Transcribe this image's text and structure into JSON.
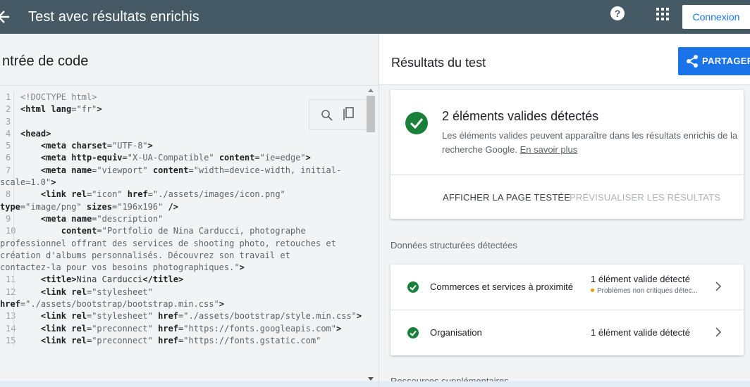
{
  "app": {
    "title": "Test avec résultats enrichis",
    "help_label": "?",
    "signin_label": "Connexion"
  },
  "left": {
    "title": "ntrée de code"
  },
  "right": {
    "title": "Résultats du test",
    "share_label": "PARTAGER",
    "summary": {
      "title": "2 éléments valides détectés",
      "desc": "Les éléments valides peuvent apparaître dans les résultats enrichis de la recherche Google.",
      "learn_more": "En savoir plus",
      "view_page": "AFFICHER LA PAGE TESTÉE",
      "preview": "PRÉVISUALISER LES RÉSULTATS"
    },
    "section_label": "Données structurées détectées",
    "items": [
      {
        "name": "Commerces et services à proximité",
        "status": "1 élément valide détecté",
        "warning": "Problèmes non critiques détec..."
      },
      {
        "name": "Organisation",
        "status": "1 élément valide détecté"
      }
    ],
    "resources_label": "Ressources supplémentaires"
  },
  "colors": {
    "topbar": "#455a64",
    "accent": "#1a73e8",
    "success": "#188038",
    "warning": "#f29900"
  },
  "code_lines": [
    {
      "ln": "1",
      "parts": [
        [
          "cmt",
          "<!DOCTYPE html>"
        ]
      ]
    },
    {
      "ln": "2",
      "parts": [
        [
          "tag",
          "<html"
        ],
        [
          "txt",
          " "
        ],
        [
          "attr",
          "lang"
        ],
        [
          "txt",
          "="
        ],
        [
          "val",
          "\"fr\""
        ],
        [
          "tag",
          ">"
        ]
      ]
    },
    {
      "ln": "3",
      "parts": []
    },
    {
      "ln": "4",
      "parts": [
        [
          "tag",
          "<head>"
        ]
      ]
    },
    {
      "ln": "5",
      "parts": [
        [
          "txt",
          "    "
        ],
        [
          "tag",
          "<meta"
        ],
        [
          "txt",
          " "
        ],
        [
          "attr",
          "charset"
        ],
        [
          "txt",
          "="
        ],
        [
          "val",
          "\"UTF-8\""
        ],
        [
          "tag",
          ">"
        ]
      ]
    },
    {
      "ln": "6",
      "parts": [
        [
          "txt",
          "    "
        ],
        [
          "tag",
          "<meta"
        ],
        [
          "txt",
          " "
        ],
        [
          "attr",
          "http-equiv"
        ],
        [
          "txt",
          "="
        ],
        [
          "val",
          "\"X-UA-Compatible\""
        ],
        [
          "txt",
          " "
        ],
        [
          "attr",
          "content"
        ],
        [
          "txt",
          "="
        ],
        [
          "val",
          "\"ie=edge\""
        ],
        [
          "tag",
          ">"
        ]
      ]
    },
    {
      "ln": "7",
      "parts": [
        [
          "txt",
          "    "
        ],
        [
          "tag",
          "<meta"
        ],
        [
          "txt",
          " "
        ],
        [
          "attr",
          "name"
        ],
        [
          "txt",
          "="
        ],
        [
          "val",
          "\"viewport\""
        ],
        [
          "txt",
          " "
        ],
        [
          "attr",
          "content"
        ],
        [
          "txt",
          "="
        ],
        [
          "val",
          "\"width=device-width, initial-"
        ]
      ]
    },
    {
      "ln": "",
      "wrap": true,
      "parts": [
        [
          "val",
          "scale=1.0\""
        ],
        [
          "tag",
          ">"
        ]
      ]
    },
    {
      "ln": "8",
      "parts": [
        [
          "txt",
          "    "
        ],
        [
          "tag",
          "<link"
        ],
        [
          "txt",
          " "
        ],
        [
          "attr",
          "rel"
        ],
        [
          "txt",
          "="
        ],
        [
          "val",
          "\"icon\""
        ],
        [
          "txt",
          " "
        ],
        [
          "attr",
          "href"
        ],
        [
          "txt",
          "="
        ],
        [
          "val",
          "\"./assets/images/icon.png\""
        ]
      ]
    },
    {
      "ln": "",
      "wrap": true,
      "parts": [
        [
          "attr",
          "type"
        ],
        [
          "txt",
          "="
        ],
        [
          "val",
          "\"image/png\""
        ],
        [
          "txt",
          " "
        ],
        [
          "attr",
          "sizes"
        ],
        [
          "txt",
          "="
        ],
        [
          "val",
          "\"196x196\""
        ],
        [
          "txt",
          " "
        ],
        [
          "tag",
          "/>"
        ]
      ]
    },
    {
      "ln": "9",
      "parts": [
        [
          "txt",
          "    "
        ],
        [
          "tag",
          "<meta"
        ],
        [
          "txt",
          " "
        ],
        [
          "attr",
          "name"
        ],
        [
          "txt",
          "="
        ],
        [
          "val",
          "\"description\""
        ]
      ]
    },
    {
      "ln": "10",
      "parts": [
        [
          "txt",
          "        "
        ],
        [
          "attr",
          "content"
        ],
        [
          "txt",
          "="
        ],
        [
          "val",
          "\"Portfolio de Nina Carducci, photographe"
        ]
      ]
    },
    {
      "ln": "",
      "wrap": true,
      "parts": [
        [
          "val",
          "professionnel offrant des services de shooting photo, retouches et"
        ]
      ]
    },
    {
      "ln": "",
      "wrap": true,
      "parts": [
        [
          "val",
          "création d'albums personnalisés. Découvrez son travail et"
        ]
      ]
    },
    {
      "ln": "",
      "wrap": true,
      "parts": [
        [
          "val",
          "contactez-la pour vos besoins photographiques.\""
        ],
        [
          "tag",
          ">"
        ]
      ]
    },
    {
      "ln": "11",
      "parts": [
        [
          "txt",
          "    "
        ],
        [
          "tag",
          "<title>"
        ],
        [
          "txt",
          "Nina Carducci"
        ],
        [
          "tag",
          "</title>"
        ]
      ]
    },
    {
      "ln": "12",
      "parts": [
        [
          "txt",
          "    "
        ],
        [
          "tag",
          "<link"
        ],
        [
          "txt",
          " "
        ],
        [
          "attr",
          "rel"
        ],
        [
          "txt",
          "="
        ],
        [
          "val",
          "\"stylesheet\""
        ]
      ]
    },
    {
      "ln": "",
      "wrap": true,
      "parts": [
        [
          "attr",
          "href"
        ],
        [
          "txt",
          "="
        ],
        [
          "val",
          "\"./assets/bootstrap/bootstrap.min.css\""
        ],
        [
          "tag",
          ">"
        ]
      ]
    },
    {
      "ln": "13",
      "parts": [
        [
          "txt",
          "    "
        ],
        [
          "tag",
          "<link"
        ],
        [
          "txt",
          " "
        ],
        [
          "attr",
          "rel"
        ],
        [
          "txt",
          "="
        ],
        [
          "val",
          "\"stylesheet\""
        ],
        [
          "txt",
          " "
        ],
        [
          "attr",
          "href"
        ],
        [
          "txt",
          "="
        ],
        [
          "val",
          "\"./assets/bootstrap/style.min.css\""
        ],
        [
          "tag",
          ">"
        ]
      ]
    },
    {
      "ln": "14",
      "parts": [
        [
          "txt",
          "    "
        ],
        [
          "tag",
          "<link"
        ],
        [
          "txt",
          " "
        ],
        [
          "attr",
          "rel"
        ],
        [
          "txt",
          "="
        ],
        [
          "val",
          "\"preconnect\""
        ],
        [
          "txt",
          " "
        ],
        [
          "attr",
          "href"
        ],
        [
          "txt",
          "="
        ],
        [
          "val",
          "\"https://fonts.googleapis.com\""
        ],
        [
          "tag",
          ">"
        ]
      ]
    },
    {
      "ln": "15",
      "parts": [
        [
          "txt",
          "    "
        ],
        [
          "tag",
          "<link"
        ],
        [
          "txt",
          " "
        ],
        [
          "attr",
          "rel"
        ],
        [
          "txt",
          "="
        ],
        [
          "val",
          "\"preconnect\""
        ],
        [
          "txt",
          " "
        ],
        [
          "attr",
          "href"
        ],
        [
          "txt",
          "="
        ],
        [
          "val",
          "\"https://fonts.gstatic.com\""
        ]
      ]
    }
  ]
}
